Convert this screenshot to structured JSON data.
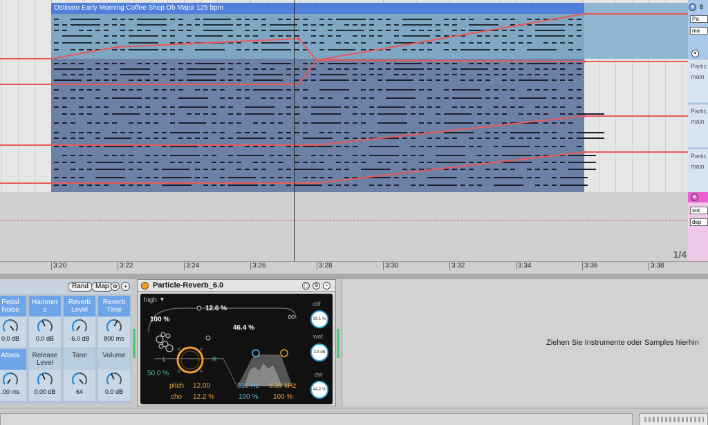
{
  "clip": {
    "title": "Ostinato Early Morning Coffee Shop Db Major 125 bpm"
  },
  "page_indicator": "1/4",
  "timeline": {
    "ticks": [
      "3:20",
      "3:22",
      "3:24",
      "3:26",
      "3:28",
      "3:30",
      "3:32",
      "3:34",
      "3:36",
      "3:38"
    ]
  },
  "tracks": {
    "track1": {
      "number": "8",
      "chip1": "Pa",
      "chip2": "ma"
    },
    "subs": [
      {
        "line1": "Partic",
        "line2": "main"
      },
      {
        "line1": "Partic",
        "line2": "main"
      },
      {
        "line1": "Partic",
        "line2": "main"
      }
    ],
    "track2": {
      "chip1": "soc",
      "chip2": "dep"
    }
  },
  "rack": {
    "rand_label": "Rand",
    "map_label": "Map",
    "macros": [
      {
        "label": "Pedal Noise",
        "value": "0.0 dB",
        "active": true
      },
      {
        "label": "Hammer s",
        "value": "0.0 dB",
        "active": true
      },
      {
        "label": "Reverb Level",
        "value": "-6.0 dB",
        "active": true
      },
      {
        "label": "Reverb Time",
        "value": "800 ms",
        "active": true
      },
      {
        "label": "Attack",
        "value": ".00 ms",
        "active": true
      },
      {
        "label": "Release Level",
        "value": "0.00 dB",
        "active": false
      },
      {
        "label": "Tone",
        "value": "64",
        "active": false
      },
      {
        "label": "Volume",
        "value": "0.0 dB",
        "active": false
      }
    ]
  },
  "reverb": {
    "title": "Particle-Reverb_6.0",
    "mode": "high",
    "size_pct": "100 %",
    "top_pct": "12.6 %",
    "mid_pct": "46.4 %",
    "left_label": "L",
    "right_label": "R",
    "spread_pct": "50.0 %",
    "pitch_label": "pitch",
    "pitch_value": "12.00",
    "cho_label": "cho",
    "cho_value": "12.2 %",
    "hz_value": "318 Hz",
    "hz_pct": "100 %",
    "khz_value": "6.39 kHz",
    "khz_pct": "100 %",
    "diff_label": "diff",
    "diff_value": "39.1 %",
    "wet_label": "wet",
    "wet_value": "3.8 dB",
    "dw_label": "dw",
    "dw_value": "44.2 %",
    "infinity": "∞"
  },
  "dropzone": {
    "hint": "Ziehen Sie Instrumente oder Samples hierhin"
  },
  "colors": {
    "accent": "#4f7fd8",
    "automation": "#e85a5a",
    "reverb_orange": "#f0a030",
    "reverb_blue": "#5ab8e8"
  }
}
